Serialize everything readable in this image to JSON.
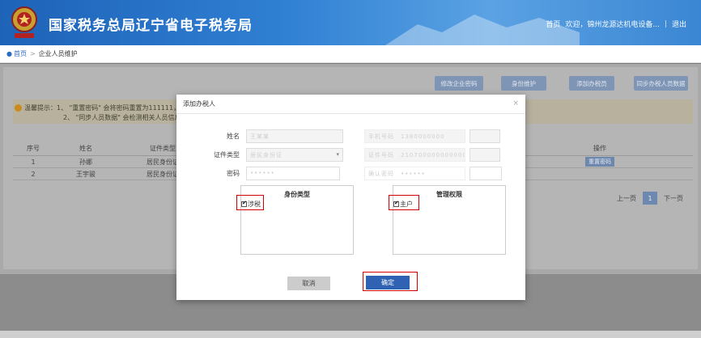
{
  "header": {
    "title": "国家税务总局辽宁省电子税务局",
    "nav_home": "首页",
    "nav_welcome": "欢迎，锦州龙源达机电设备...",
    "nav_sep": "|",
    "nav_logout": "退出"
  },
  "breadcrumb": {
    "home": "首页",
    "arrow": ">",
    "current": "企业人员维护"
  },
  "actions": [
    "修改企业密码",
    "身份维护",
    "添加办税员",
    "同步办税人员数据"
  ],
  "notice": {
    "line1": "温馨提示：1、 \"重置密码\" 会将密码重置为111111，",
    "line2": "2、 \"同步人员数据\" 会检测相关人员信息"
  },
  "table": {
    "headers": [
      "序号",
      "姓名",
      "证件类型",
      "操作"
    ],
    "rows": [
      {
        "idx": "1",
        "name": "孙娜",
        "type": "居民身份证",
        "op": "重置密码"
      },
      {
        "idx": "2",
        "name": "王宇骏",
        "type": "居民身份证",
        "op": ""
      }
    ]
  },
  "pager": {
    "prev": "上一页",
    "current": "1",
    "next": "下一页"
  },
  "modal": {
    "title": "添加办税人",
    "close": "×",
    "fields": {
      "name_label": "姓名",
      "name_value": "王某某",
      "idtype_label": "证件类型",
      "idtype_value": "居民身份证",
      "password_label": "密码",
      "password_value": "••••••",
      "right1_label": "手机号码",
      "right1_value": "1380000000",
      "right2_label": "证件号码",
      "right2_value": "2107000000000000",
      "right3_label": "确认密码",
      "right3_value": "••••••"
    },
    "identity_group": {
      "title": "身份类型",
      "option": "涉税"
    },
    "permission_group": {
      "title": "管理权限",
      "option": "主户"
    },
    "cancel": "取消",
    "confirm": "确定"
  },
  "colors": {
    "header_blue": "#2f7fd3",
    "primary_button": "#2f62b2",
    "highlight_red": "#d40000"
  }
}
